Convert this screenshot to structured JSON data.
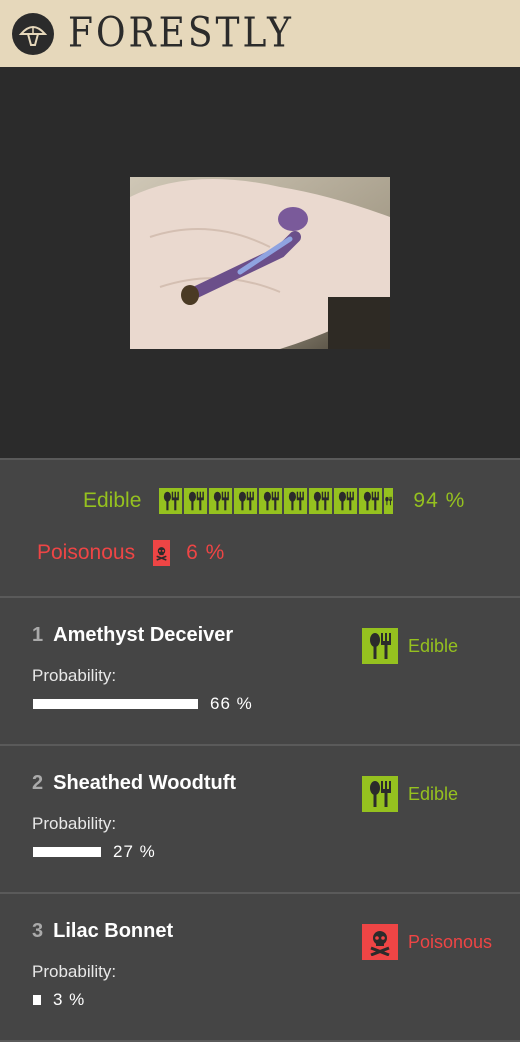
{
  "app": {
    "title": "FORESTLY",
    "logo_icon": "mushroom-icon"
  },
  "colors": {
    "edible": "#95c11f",
    "poisonous": "#ee4545",
    "header_bg": "#e6d8bb",
    "dark": "#2b2b2b"
  },
  "summary": {
    "edible": {
      "label": "Edible",
      "percent": "94 %",
      "fraction": 0.94,
      "icon": "fork-spoon-icon"
    },
    "poisonous": {
      "label": "Poisonous",
      "percent": "6 %",
      "fraction": 0.06,
      "icon": "skull-crossbones-icon"
    }
  },
  "results": [
    {
      "rank": "1",
      "name": "Amethyst Deceiver",
      "probability_label": "Probability:",
      "percent": "66 %",
      "fraction": 0.66,
      "verdict": "Edible",
      "verdict_icon": "fork-spoon-icon"
    },
    {
      "rank": "2",
      "name": "Sheathed Woodtuft",
      "probability_label": "Probability:",
      "percent": "27 %",
      "fraction": 0.27,
      "verdict": "Edible",
      "verdict_icon": "fork-spoon-icon"
    },
    {
      "rank": "3",
      "name": "Lilac Bonnet",
      "probability_label": "Probability:",
      "percent": "3 %",
      "fraction": 0.03,
      "verdict": "Poisonous",
      "verdict_icon": "skull-crossbones-icon"
    }
  ]
}
